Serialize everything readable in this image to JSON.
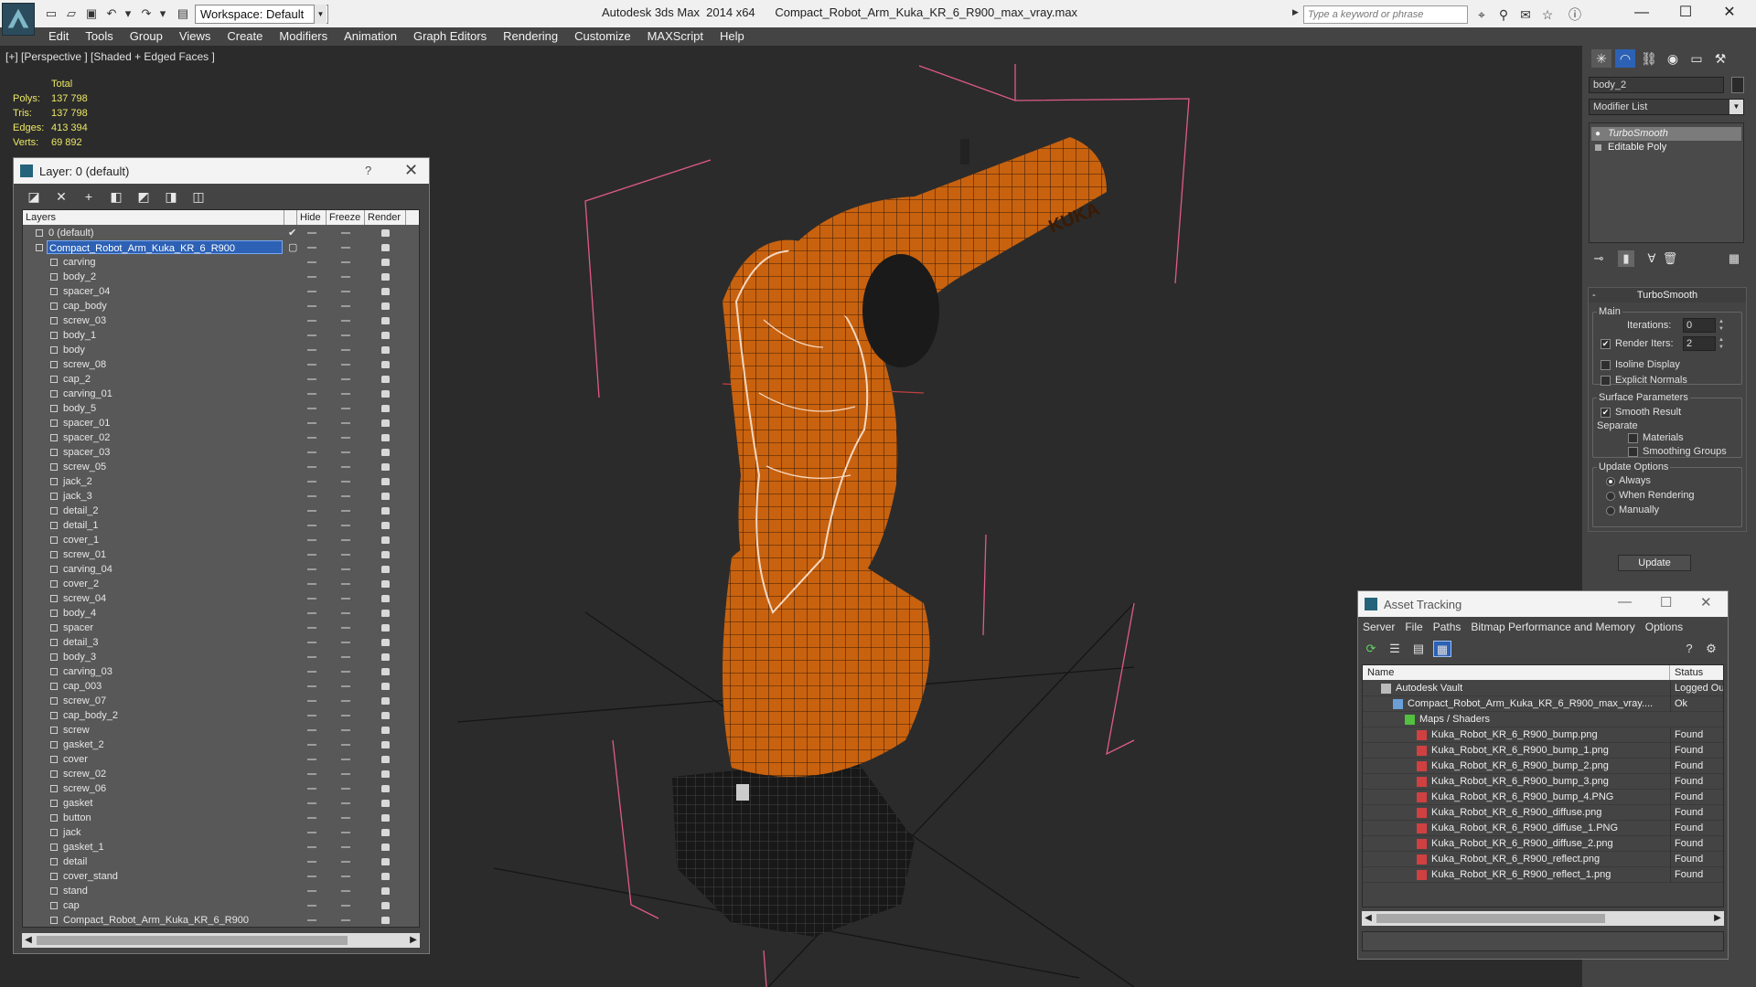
{
  "title_bar": {
    "workspace": "Workspace: Default",
    "app_title": "Autodesk 3ds Max  2014 x64",
    "file_name": "Compact_Robot_Arm_Kuka_KR_6_R900_max_vray.max",
    "search_placeholder": "Type a keyword or phrase"
  },
  "menu": [
    "Edit",
    "Tools",
    "Group",
    "Views",
    "Create",
    "Modifiers",
    "Animation",
    "Graph Editors",
    "Rendering",
    "Customize",
    "MAXScript",
    "Help"
  ],
  "viewport": {
    "label": "[+] [Perspective ] [Shaded + Edged Faces ]",
    "stats": {
      "total_label": "Total",
      "rows": [
        {
          "label": "Polys:",
          "value": "137 798"
        },
        {
          "label": "Tris:",
          "value": "137 798"
        },
        {
          "label": "Edges:",
          "value": "413 394"
        },
        {
          "label": "Verts:",
          "value": "69 892"
        }
      ]
    },
    "model_text": "KUKA"
  },
  "layer_dialog": {
    "title": "Layer: 0 (default)",
    "help": "?",
    "columns": {
      "layers": "Layers",
      "hide": "Hide",
      "freeze": "Freeze",
      "render": "Render"
    },
    "default_layer": "0 (default)",
    "selected_layer": "Compact_Robot_Arm_Kuka_KR_6_R900",
    "objects": [
      "carving",
      "body_2",
      "spacer_04",
      "cap_body",
      "screw_03",
      "body_1",
      "body",
      "screw_08",
      "cap_2",
      "carving_01",
      "body_5",
      "spacer_01",
      "spacer_02",
      "spacer_03",
      "screw_05",
      "jack_2",
      "jack_3",
      "detail_2",
      "detail_1",
      "cover_1",
      "screw_01",
      "carving_04",
      "cover_2",
      "screw_04",
      "body_4",
      "spacer",
      "detail_3",
      "body_3",
      "carving_03",
      "cap_003",
      "screw_07",
      "cap_body_2",
      "screw",
      "gasket_2",
      "cover",
      "screw_02",
      "screw_06",
      "gasket",
      "button",
      "jack",
      "gasket_1",
      "detail",
      "cover_stand",
      "stand",
      "cap",
      "Compact_Robot_Arm_Kuka_KR_6_R900"
    ]
  },
  "command_panel": {
    "object_name": "body_2",
    "modifier_list": "Modifier List",
    "stack": [
      "TurboSmooth",
      "Editable Poly"
    ],
    "rollout_title": "TurboSmooth",
    "main_label": "Main",
    "iterations_label": "Iterations:",
    "iterations_value": "0",
    "render_iters_label": "Render Iters:",
    "render_iters_value": "2",
    "render_iters_checked": true,
    "isoline_label": "Isoline Display",
    "explicit_normals_label": "Explicit Normals",
    "surface_params_label": "Surface Parameters",
    "smooth_result_label": "Smooth Result",
    "separate_label": "Separate",
    "materials_label": "Materials",
    "smoothing_groups_label": "Smoothing Groups",
    "update_options_label": "Update Options",
    "update_options": [
      "Always",
      "When Rendering",
      "Manually"
    ],
    "update_selected": "Always",
    "update_button": "Update"
  },
  "asset_tracking": {
    "title": "Asset Tracking",
    "menu": [
      "Server",
      "File",
      "Paths",
      "Bitmap Performance and Memory",
      "Options"
    ],
    "columns": {
      "name": "Name",
      "status": "Status"
    },
    "rows": [
      {
        "name": "Autodesk Vault",
        "status": "Logged Ou",
        "level": 0,
        "icon": "vault"
      },
      {
        "name": "Compact_Robot_Arm_Kuka_KR_6_R900_max_vray....",
        "status": "Ok",
        "level": 1,
        "icon": "file"
      },
      {
        "name": "Maps / Shaders",
        "status": "",
        "level": 2,
        "icon": "maps"
      },
      {
        "name": "Kuka_Robot_KR_6_R900_bump.png",
        "status": "Found",
        "level": 3,
        "icon": "png"
      },
      {
        "name": "Kuka_Robot_KR_6_R900_bump_1.png",
        "status": "Found",
        "level": 3,
        "icon": "png"
      },
      {
        "name": "Kuka_Robot_KR_6_R900_bump_2.png",
        "status": "Found",
        "level": 3,
        "icon": "png"
      },
      {
        "name": "Kuka_Robot_KR_6_R900_bump_3.png",
        "status": "Found",
        "level": 3,
        "icon": "png"
      },
      {
        "name": "Kuka_Robot_KR_6_R900_bump_4.PNG",
        "status": "Found",
        "level": 3,
        "icon": "png"
      },
      {
        "name": "Kuka_Robot_KR_6_R900_diffuse.png",
        "status": "Found",
        "level": 3,
        "icon": "png"
      },
      {
        "name": "Kuka_Robot_KR_6_R900_diffuse_1.PNG",
        "status": "Found",
        "level": 3,
        "icon": "png"
      },
      {
        "name": "Kuka_Robot_KR_6_R900_diffuse_2.png",
        "status": "Found",
        "level": 3,
        "icon": "png"
      },
      {
        "name": "Kuka_Robot_KR_6_R900_reflect.png",
        "status": "Found",
        "level": 3,
        "icon": "png"
      },
      {
        "name": "Kuka_Robot_KR_6_R900_reflect_1.png",
        "status": "Found",
        "level": 3,
        "icon": "png"
      }
    ]
  },
  "colors": {
    "robot_orange": "#c8620f",
    "selection_blue": "#2c61b5",
    "stats_yellow": "#ece866",
    "gizmo_pink": "#e05a8a"
  }
}
